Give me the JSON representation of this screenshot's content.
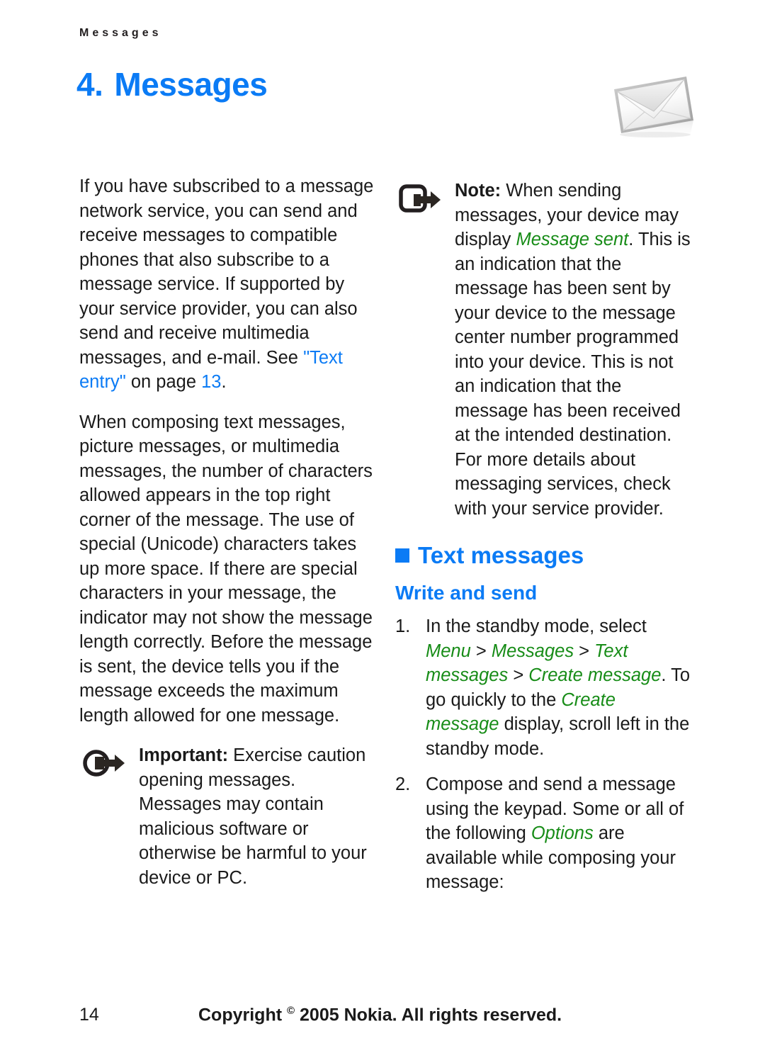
{
  "header": {
    "running_head": "Messages"
  },
  "title": {
    "number": "4.",
    "text": "Messages"
  },
  "icons": {
    "envelope": "envelope-illustration",
    "note": "note-arrow-icon",
    "important": "important-arrow-icon",
    "bullet": "blue-square-bullet"
  },
  "colors": {
    "accent_blue": "#0b7bf5",
    "menu_green": "#178c17",
    "body_text": "#1a1a1a",
    "page_background": "#ffffff"
  },
  "left_column": {
    "paragraph_1": {
      "part_1": "If you have subscribed to a message network service, you can send and receive messages to compatible phones that also subscribe to a message service. If supported by your service provider, you can also send and receive multimedia messages, and e-mail. See ",
      "link_1": "\"Text entry\"",
      "part_2": " on page ",
      "link_2": "13",
      "part_3": "."
    },
    "paragraph_2": "When composing text messages, picture messages, or multimedia messages, the number of characters allowed appears in the top right corner of the message. The use of special (Unicode) characters takes up more space. If there are special characters in your message, the indicator may not show the message length correctly. Before the message is sent, the device tells you if the message exceeds the maximum length allowed for one message.",
    "important_note": {
      "label": "Important:",
      "text": " Exercise caution opening messages. Messages may contain malicious software or otherwise be harmful to your device or PC."
    }
  },
  "right_column": {
    "note": {
      "label": "Note:",
      "part_1": " When sending messages, your device may display ",
      "emphasis": "Message sent",
      "part_2": ". This is an indication that the message has been sent by your device to the message center number programmed into your device. This is not an indication that the message has been received at the intended destination. For more details about messaging services, check with your service provider."
    },
    "section_heading": "Text messages",
    "sub_heading": "Write and send",
    "steps": [
      {
        "marker": "1.",
        "part_1": "In the standby mode, select ",
        "menu_1": "Menu",
        "sep_1": " > ",
        "menu_2": "Messages",
        "sep_2": " > ",
        "menu_3": "Text messages",
        "sep_3": " > ",
        "menu_4": "Create message",
        "part_2": ". To go quickly to the ",
        "menu_5": "Create message",
        "part_3": " display, scroll left in the standby mode."
      },
      {
        "marker": "2.",
        "part_1": "Compose and send a message using the keypad. Some or all of the following ",
        "menu_1": "Options",
        "part_2": " are available while composing your message:"
      }
    ]
  },
  "footer": {
    "page_number": "14",
    "copyright_before": "Copyright ",
    "copyright_symbol": "©",
    "copyright_after": " 2005 Nokia. All rights reserved."
  }
}
